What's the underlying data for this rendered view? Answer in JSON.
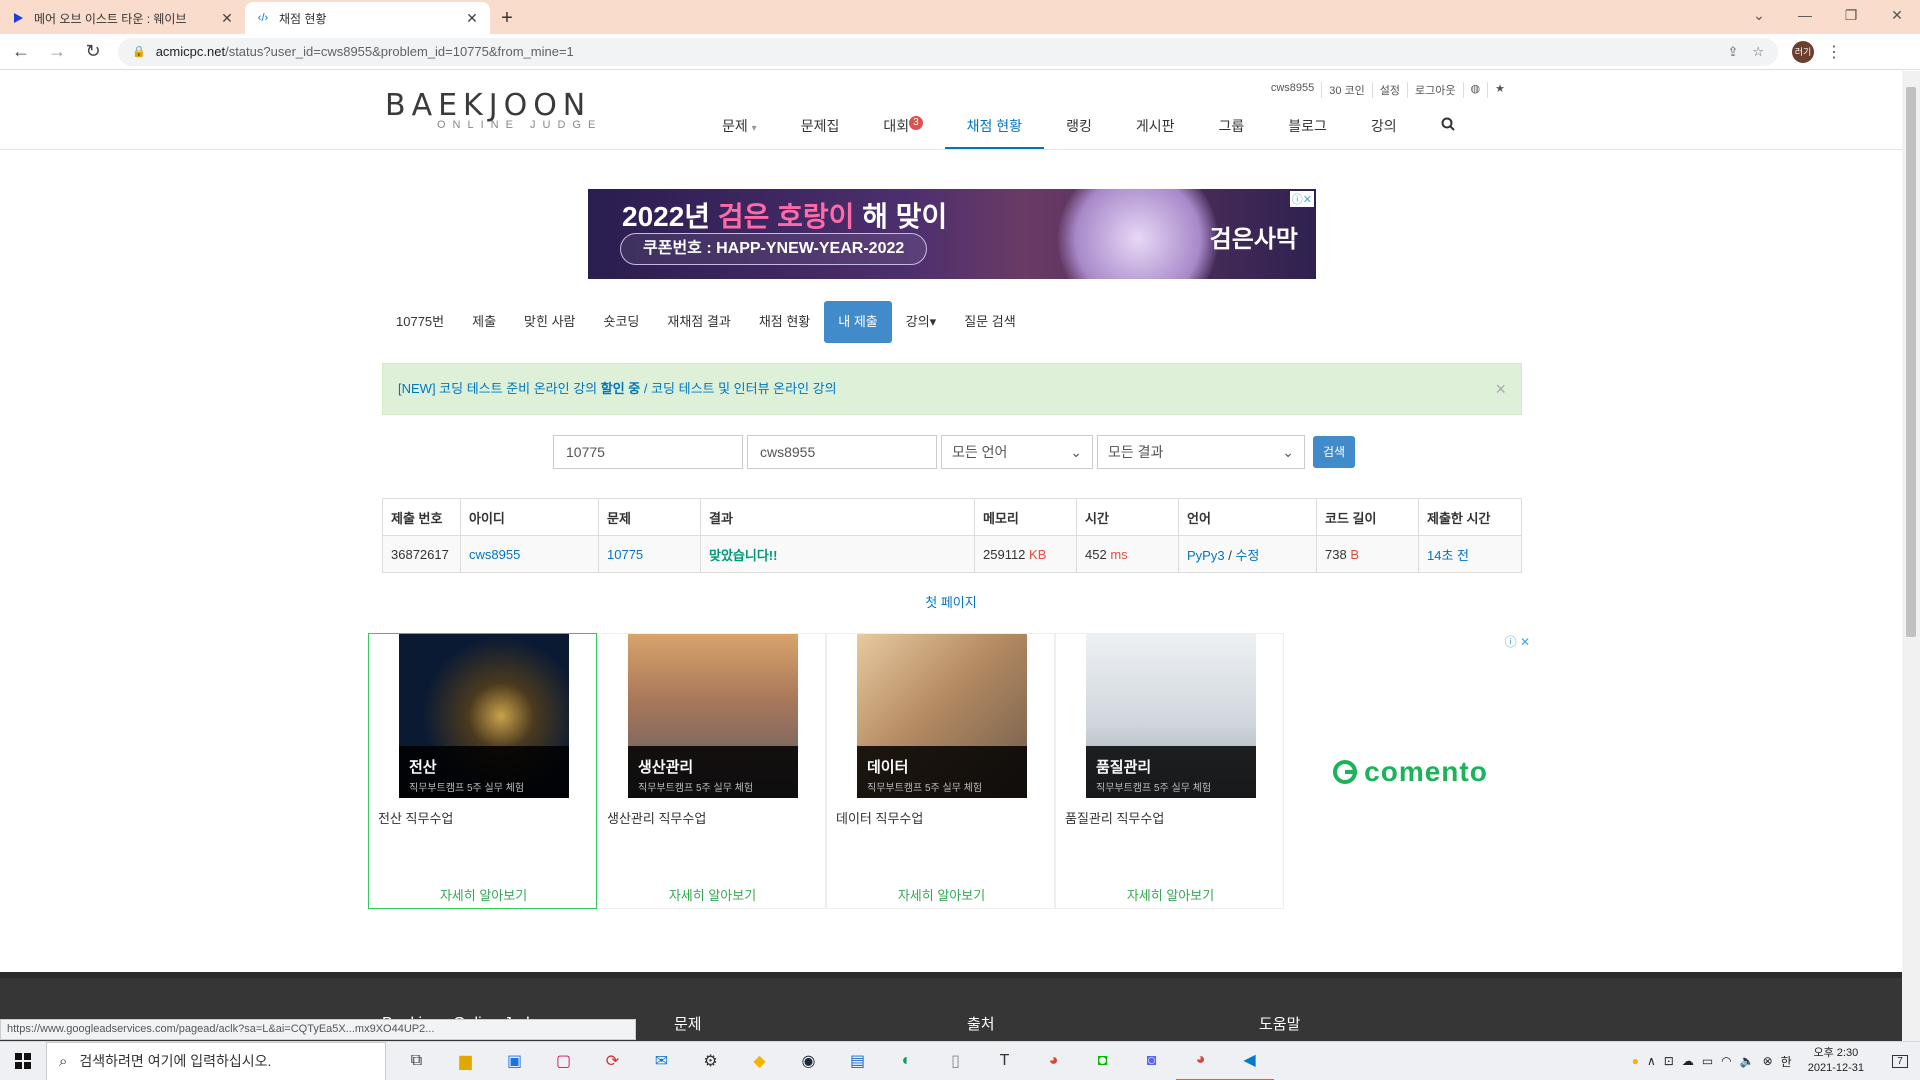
{
  "browser": {
    "tabs": [
      {
        "title": "메어 오브 이스트 타운 : 웨이브",
        "favicon": "wavve-play-icon"
      },
      {
        "title": "채점 현황",
        "favicon": "code-icon"
      }
    ],
    "url_host": "acmicpc.net",
    "url_rest": "/status?user_id=cws8955&problem_id=10775&from_mine=1",
    "profile_initials": "러기"
  },
  "site": {
    "logo_main": "BAEKJOON",
    "logo_sub": "ONLINE JUDGE",
    "toplinks": [
      "cws8955",
      "30 코인",
      "설정",
      "로그아웃"
    ],
    "nav": [
      {
        "label": "문제",
        "caret": "▾"
      },
      {
        "label": "문제집"
      },
      {
        "label": "대회",
        "badge": "3"
      },
      {
        "label": "채점 현황",
        "active": true
      },
      {
        "label": "랭킹"
      },
      {
        "label": "게시판"
      },
      {
        "label": "그룹"
      },
      {
        "label": "블로그"
      },
      {
        "label": "강의"
      }
    ]
  },
  "banner": {
    "title_pre": "2022년 ",
    "title_hl": "검은 호랑이",
    "title_post": " 해 맞이",
    "coupon": "쿠폰번호 : HAPP-YNEW-YEAR-2022",
    "brand": "검은사막"
  },
  "subnav": [
    "10775번",
    "제출",
    "맞힌 사람",
    "숏코딩",
    "재채점 결과",
    "채점 현황",
    "내 제출",
    "강의▾",
    "질문 검색"
  ],
  "alert": {
    "prefix": "[NEW] 코딩 테스트 준비 온라인 강의 ",
    "strong": "할인 중",
    "suffix": " / 코딩 테스트 및 인터뷰 온라인 강의",
    "close": "×"
  },
  "search": {
    "problem_id": "10775",
    "user_id": "cws8955",
    "language": "모든 언어",
    "result": "모든 결과",
    "button": "검색"
  },
  "table": {
    "headers": [
      "제출 번호",
      "아이디",
      "문제",
      "결과",
      "메모리",
      "시간",
      "언어",
      "코드 길이",
      "제출한 시간"
    ],
    "row": {
      "submission_id": "36872617",
      "user": "cws8955",
      "problem": "10775",
      "result": "맞았습니다!!",
      "memory": "259112",
      "memory_unit": "KB",
      "time": "452",
      "time_unit": "ms",
      "language": "PyPy3",
      "edit": "수정",
      "code_length": "738",
      "code_unit": "B",
      "submitted": "14초 전"
    }
  },
  "first_page": "첫 페이지",
  "ads": {
    "cards": [
      {
        "title": "전산",
        "sub": "직무부트캠프 5주 실무 체험",
        "desc": "전산 직무수업",
        "more": "자세히 알아보기",
        "bg": "#0b1a33"
      },
      {
        "title": "생산관리",
        "sub": "직무부트캠프 5주 실무 체험",
        "desc": "생산관리 직무수업",
        "more": "자세히 알아보기",
        "bg": "#8a6a50"
      },
      {
        "title": "데이터",
        "sub": "직무부트캠프 5주 실무 체험",
        "desc": "데이터 직무수업",
        "more": "자세히 알아보기",
        "bg": "#b48a62"
      },
      {
        "title": "품질관리",
        "sub": "직무부트캠프 5주 실무 체험",
        "desc": "품질관리 직무수업",
        "more": "자세히 알아보기",
        "bg": "#cfd6dc"
      }
    ],
    "brand": "comento"
  },
  "footer": {
    "brand": "Baekjoon Online Judge",
    "cols": [
      "문제",
      "출처",
      "도움말"
    ]
  },
  "status_url": "https://www.googleadservices.com/pagead/aclk?sa=L&ai=CQTyEa5X...mx9XO44UP2...",
  "taskbar": {
    "search_placeholder": "검색하려면 여기에 입력하십시오.",
    "time": "오후 2:30",
    "date": "2021-12-31",
    "ime": "한",
    "notif_count": "7"
  },
  "colors": {
    "accent": "#0076c0",
    "active_tab": "#428bca",
    "alert_bg": "#dff0d8",
    "ok_green": "#009874",
    "tab_strip": "#f9dccb"
  }
}
